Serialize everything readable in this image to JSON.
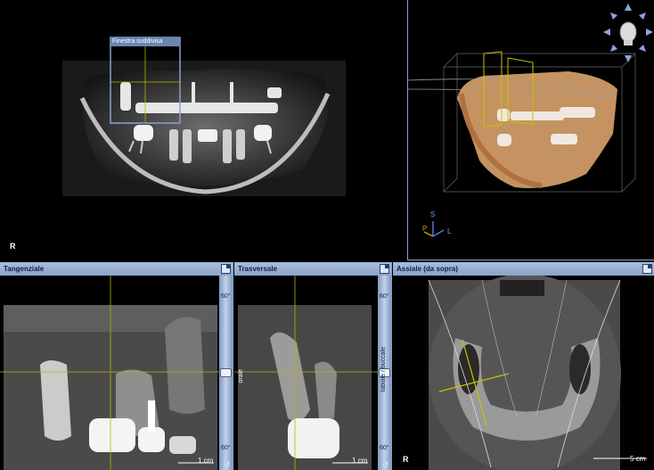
{
  "top_left": {
    "subwindow_title": "Finestra suddivisa",
    "orientation_label": "R"
  },
  "top_right": {
    "axis_superior": "S",
    "axis_posterior": "P",
    "axis_left": "L"
  },
  "panels": {
    "tangential": {
      "title": "Tangenziale",
      "scale": "1 cm",
      "tick_top": "60°",
      "tick_bottom": "60°"
    },
    "transversal": {
      "title": "Trasversale",
      "scale": "1 cm",
      "tick_top": "60°",
      "tick_bottom": "60°",
      "side_left": "orale",
      "side_right": "labiale / buccale"
    },
    "axial": {
      "title": "Assiale (da sopra)",
      "scale": "5 cm",
      "orientation_label": "R"
    }
  },
  "colors": {
    "accent": "#8aa3c8",
    "crosshair": "#b8b400",
    "volume_bone": "#d9a36b"
  },
  "icons": {
    "view_cube": "head-orientation-icon",
    "maximize": "maximize-icon",
    "rotate": "rotate-icon"
  }
}
